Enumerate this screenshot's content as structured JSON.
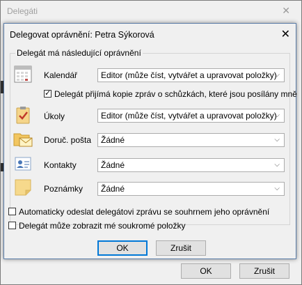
{
  "outer_dialog": {
    "title": "Delegáti",
    "close_glyph": "✕",
    "ok_label": "OK",
    "cancel_label": "Zrušit"
  },
  "dialog": {
    "title": "Delegovat oprávnění: Petra Sýkorová",
    "close_glyph": "✕",
    "group_label": "Delegát má následující oprávnění",
    "rows": [
      {
        "icon": "calendar-icon",
        "label": "Kalendář",
        "value": "Editor (může číst, vytvářet a upravovat položky)"
      },
      {
        "icon": "tasks-icon",
        "label": "Úkoly",
        "value": "Editor (může číst, vytvářet a upravovat položky)"
      },
      {
        "icon": "inbox-folder-icon",
        "label": "Doruč. pošta",
        "value": "Žádné"
      },
      {
        "icon": "contacts-icon",
        "label": "Kontakty",
        "value": "Žádné"
      },
      {
        "icon": "notes-icon",
        "label": "Poznámky",
        "value": "Žádné"
      }
    ],
    "meeting_copies": {
      "label": "Delegát přijímá kopie zpráv o schůzkách, které jsou posílány mně",
      "checked": true
    },
    "send_summary": {
      "label": "Automaticky odeslat delegátovi zprávu se souhrnem jeho oprávnění",
      "checked": false
    },
    "private_items": {
      "label": "Delegát může zobrazit mé soukromé položky",
      "checked": false
    },
    "ok_label": "OK",
    "cancel_label": "Zrušit",
    "chevron_glyph": "⌵"
  },
  "colors": {
    "accent": "#0078d7",
    "dialog_bg": "#f0f0f0"
  }
}
